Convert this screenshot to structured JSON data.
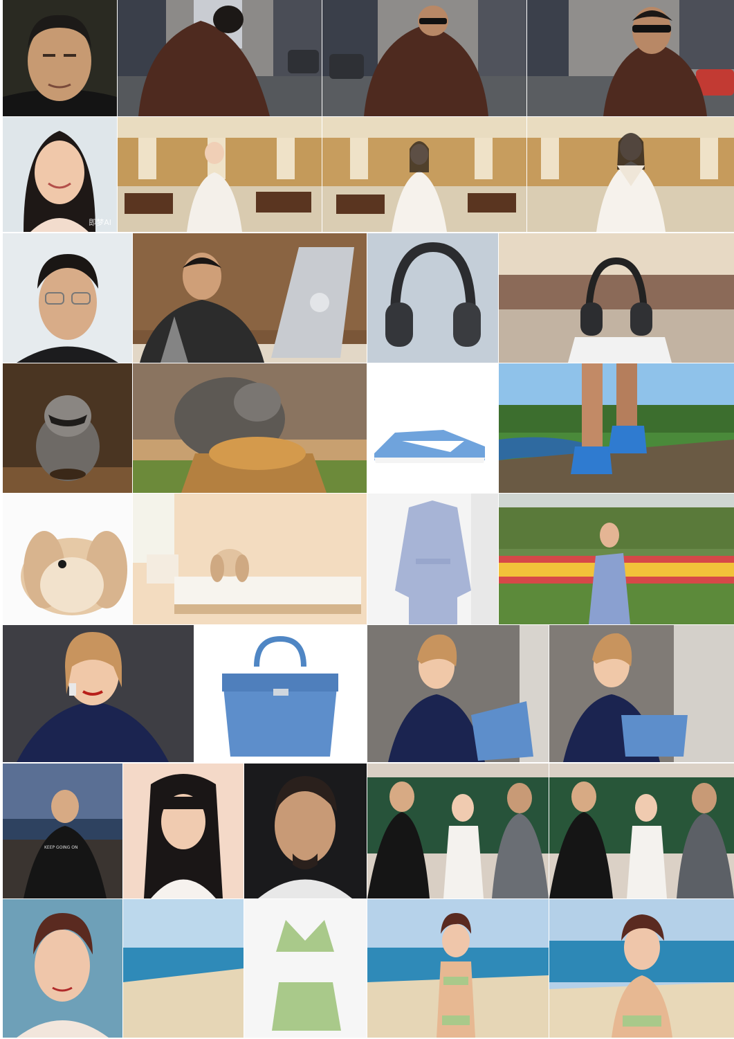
{
  "grid": {
    "rows": [
      {
        "id": "row-1",
        "subject": "man-in-brown-hood",
        "tiles": [
          "reference-portrait",
          "city-street-back",
          "city-street-turning",
          "city-street-side"
        ]
      },
      {
        "id": "row-2",
        "subject": "woman-in-white-gown",
        "tiles": [
          "reference-portrait",
          "palace-hall-1",
          "palace-hall-2",
          "palace-hall-3"
        ]
      },
      {
        "id": "row-3",
        "subject": "man-and-headphones",
        "tiles": [
          "reference-portrait",
          "man-at-laptop",
          "headphones-product",
          "headphones-in-mall"
        ]
      },
      {
        "id": "row-4",
        "subject": "raccoon-and-sneakers",
        "tiles": [
          "raccoon-reference",
          "raccoon-fried-chicken",
          "sneakers-product",
          "sneakers-walking"
        ]
      },
      {
        "id": "row-5",
        "subject": "rabbit-and-dress",
        "tiles": [
          "rabbit-reference",
          "rabbit-on-bed",
          "dress-product",
          "dress-in-garden"
        ]
      },
      {
        "id": "row-6",
        "subject": "woman-and-handbag",
        "tiles": [
          "reference-portrait",
          "handbag-product",
          "holding-handbag-1",
          "holding-handbag-2"
        ]
      },
      {
        "id": "row-7",
        "subject": "three-people-classroom",
        "tiles": [
          "man-reference",
          "woman-reference",
          "man2-reference",
          "classroom-1",
          "classroom-2"
        ]
      },
      {
        "id": "row-8",
        "subject": "woman-beach-bikini",
        "tiles": [
          "portrait-reference",
          "beach-reference",
          "bikini-product",
          "beach-result-1",
          "beach-result-2"
        ]
      }
    ],
    "watermark_text": "即梦AI",
    "shirt_text": "KEEP GOING ON"
  },
  "colors": {
    "sky": "#9fc4e6",
    "skin": "#e4b594",
    "brown_coat": "#4e2a1f",
    "gold_hall": "#c49a5a",
    "blue_product": "#6fa3dc",
    "navy_dress": "#1b2450",
    "chalkboard": "#27533a",
    "bikini_green": "#a9c98a",
    "sea": "#2f8ab8",
    "sand": "#e6d6b6"
  }
}
